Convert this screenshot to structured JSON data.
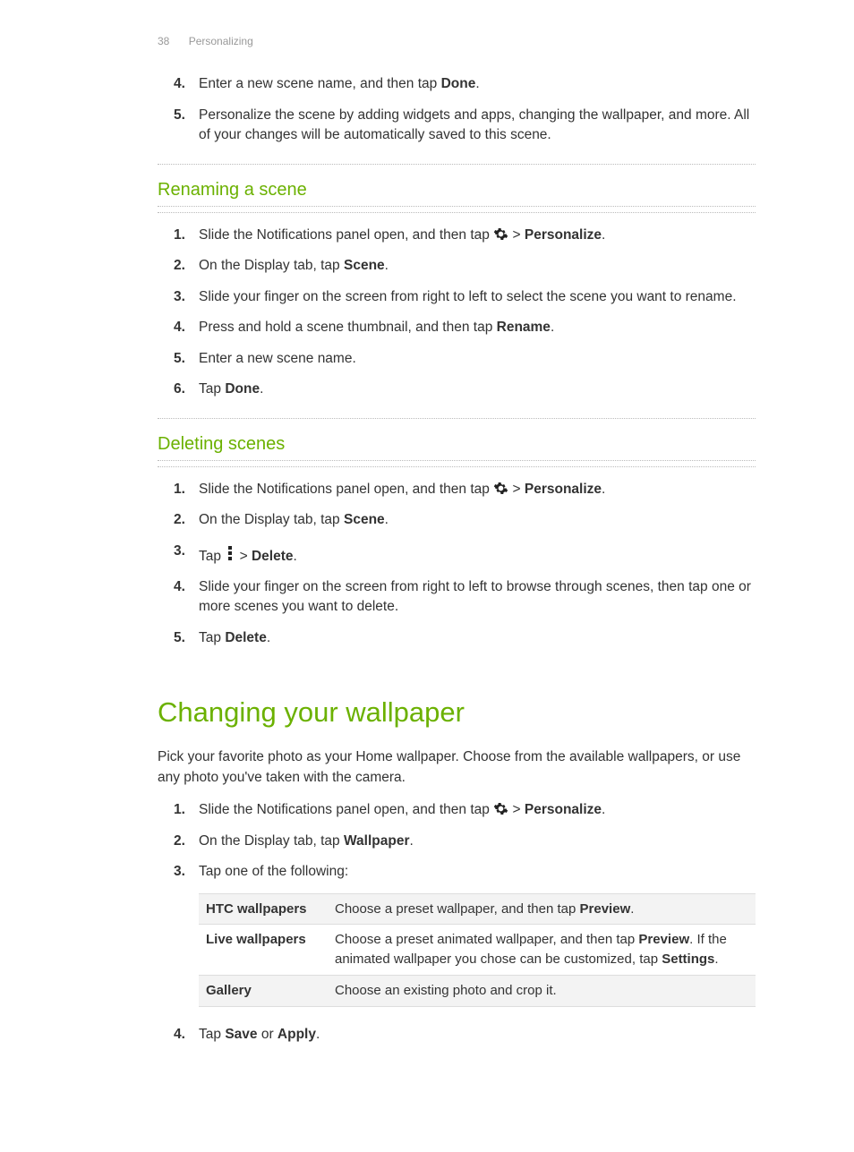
{
  "header": {
    "page_number": "38",
    "section": "Personalizing"
  },
  "intro_steps": [
    {
      "n": "4.",
      "pre": "Enter a new scene name, and then tap ",
      "b1": "Done",
      "post": "."
    },
    {
      "n": "5.",
      "pre": "Personalize the scene by adding widgets and apps, changing the wallpaper, and more. All of your changes will be automatically saved to this scene.",
      "b1": "",
      "post": ""
    }
  ],
  "renaming": {
    "heading": "Renaming a scene",
    "steps": [
      {
        "n": "1.",
        "pre": "Slide the Notifications panel open, and then tap ",
        "icon": "gear",
        "mid": " > ",
        "b1": "Personalize",
        "post": "."
      },
      {
        "n": "2.",
        "pre": "On the Display tab, tap ",
        "b1": "Scene",
        "post": "."
      },
      {
        "n": "3.",
        "pre": "Slide your finger on the screen from right to left to select the scene you want to rename."
      },
      {
        "n": "4.",
        "pre": "Press and hold a scene thumbnail, and then tap ",
        "b1": "Rename",
        "post": "."
      },
      {
        "n": "5.",
        "pre": "Enter a new scene name."
      },
      {
        "n": "6.",
        "pre": "Tap ",
        "b1": "Done",
        "post": "."
      }
    ]
  },
  "deleting": {
    "heading": "Deleting scenes",
    "steps": [
      {
        "n": "1.",
        "pre": "Slide the Notifications panel open, and then tap ",
        "icon": "gear",
        "mid": " > ",
        "b1": "Personalize",
        "post": "."
      },
      {
        "n": "2.",
        "pre": "On the Display tab, tap ",
        "b1": "Scene",
        "post": "."
      },
      {
        "n": "3.",
        "pre": "Tap ",
        "icon": "menu",
        "mid": " > ",
        "b1": "Delete",
        "post": "."
      },
      {
        "n": "4.",
        "pre": "Slide your finger on the screen from right to left to browse through scenes, then tap one or more scenes you want to delete."
      },
      {
        "n": "5.",
        "pre": "Tap ",
        "b1": "Delete",
        "post": "."
      }
    ]
  },
  "wallpaper": {
    "heading": "Changing your wallpaper",
    "intro": "Pick your favorite photo as your Home wallpaper. Choose from the available wallpapers, or use any photo you've taken with the camera.",
    "steps": [
      {
        "n": "1.",
        "pre": "Slide the Notifications panel open, and then tap ",
        "icon": "gear",
        "mid": " > ",
        "b1": "Personalize",
        "post": "."
      },
      {
        "n": "2.",
        "pre": "On the Display tab, tap ",
        "b1": "Wallpaper",
        "post": "."
      },
      {
        "n": "3.",
        "pre": "Tap one of the following:"
      }
    ],
    "table": [
      {
        "key": "HTC wallpapers",
        "desc_pre": "Choose a preset wallpaper, and then tap ",
        "b1": "Preview",
        "desc_post": "."
      },
      {
        "key": "Live wallpapers",
        "desc_pre": "Choose a preset animated wallpaper, and then tap ",
        "b1": "Preview",
        "desc_mid": ". If the animated wallpaper you chose can be customized, tap ",
        "b2": "Settings",
        "desc_post": "."
      },
      {
        "key": "Gallery",
        "desc_pre": "Choose an existing photo and crop it."
      }
    ],
    "step4": {
      "n": "4.",
      "pre": "Tap ",
      "b1": "Save",
      "mid": " or ",
      "b2": "Apply",
      "post": "."
    }
  }
}
